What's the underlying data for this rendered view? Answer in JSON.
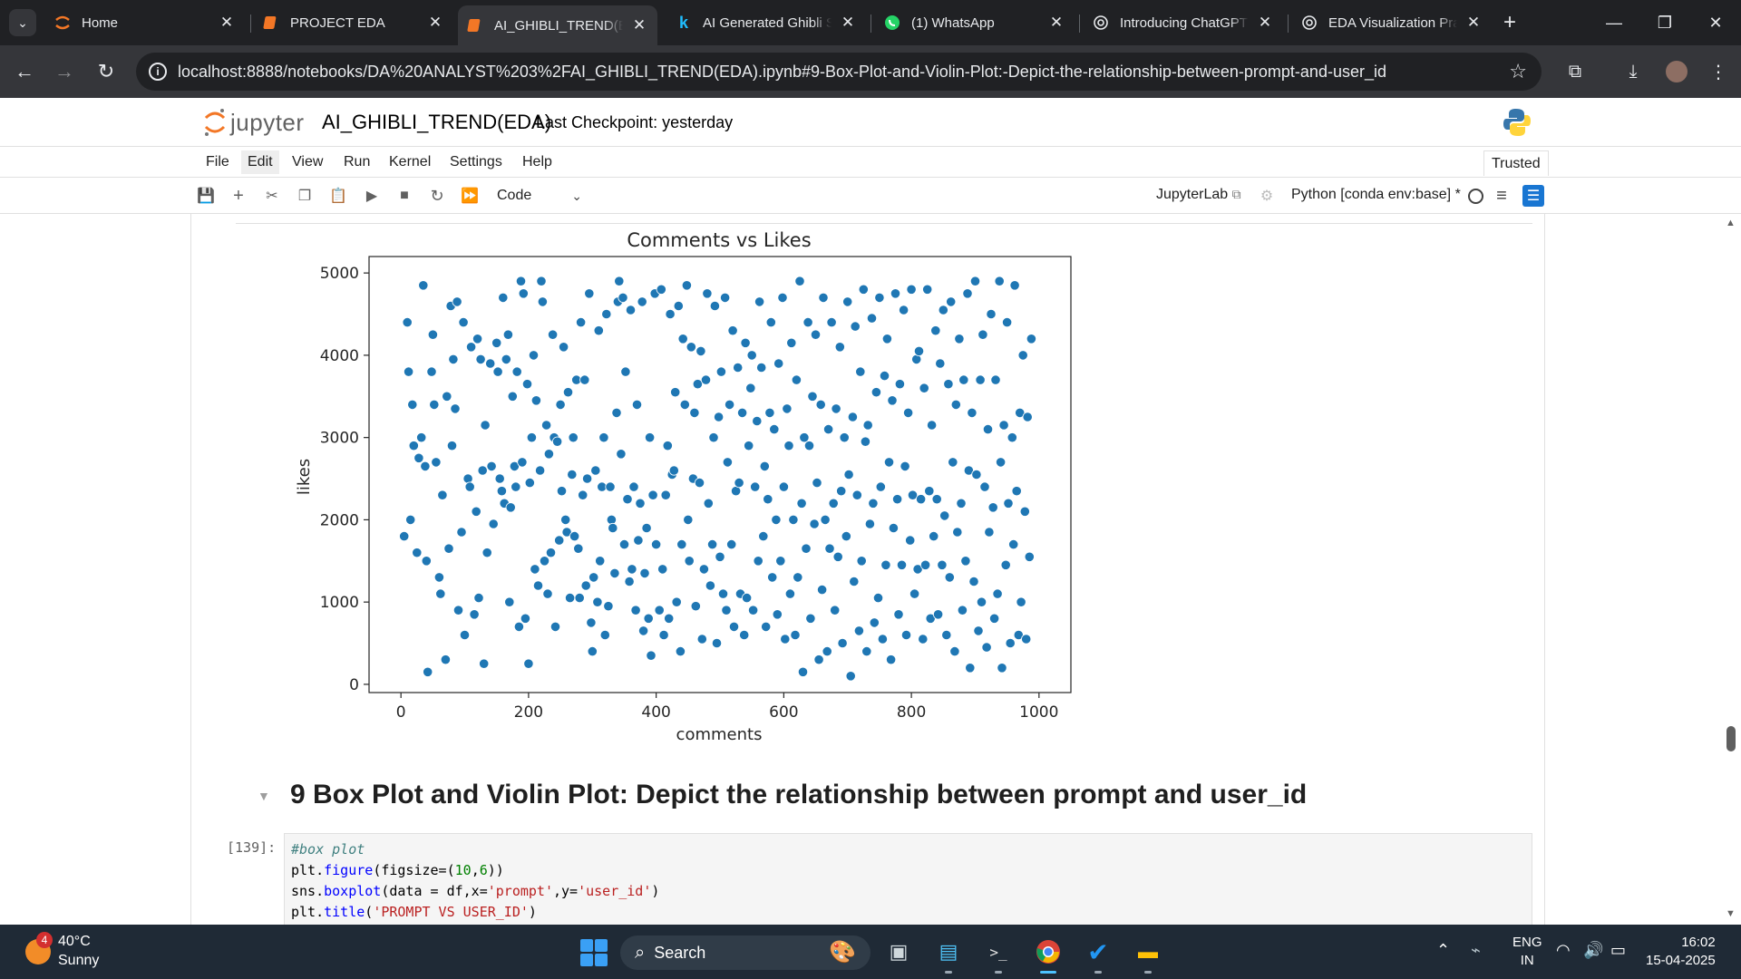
{
  "browser": {
    "tabs": [
      {
        "title": "Home",
        "icon": "jupyter-icon"
      },
      {
        "title": "PROJECT EDA",
        "icon": "jupyter-notebook-icon"
      },
      {
        "title": "AI_GHIBLI_TREND(ED",
        "icon": "jupyter-notebook-icon",
        "active": true
      },
      {
        "title": "AI Generated Ghibli S",
        "icon": "kaggle-icon"
      },
      {
        "title": "(1) WhatsApp",
        "icon": "whatsapp-icon"
      },
      {
        "title": "Introducing ChatGPT",
        "icon": "openai-icon"
      },
      {
        "title": "EDA Visualization Pra",
        "icon": "openai-icon"
      }
    ],
    "url": "localhost:8888/notebooks/DA%20ANALYST%203%2FAI_GHIBLI_TREND(EDA).ipynb#9-Box-Plot-and-Violin-Plot:-Depict-the-relationship-between-prompt-and-user_id"
  },
  "jupyter": {
    "logo_text": "jupyter",
    "notebook_title": "AI_GHIBLI_TREND(EDA)",
    "checkpoint": "Last Checkpoint: yesterday",
    "menu": [
      "File",
      "Edit",
      "View",
      "Run",
      "Kernel",
      "Settings",
      "Help"
    ],
    "trusted": "Trusted",
    "cell_type": "Code",
    "lab_link": "JupyterLab",
    "kernel": "Python [conda env:base] *"
  },
  "notebook": {
    "heading": "9 Box Plot and Violin Plot: Depict the relationship between prompt and user_id",
    "prompt": "[139]:",
    "code": {
      "line1": "#box plot",
      "line2": [
        "plt.",
        "figure",
        "(figsize=(",
        "10",
        ",",
        "6",
        "))"
      ],
      "line3": [
        "sns.",
        "boxplot",
        "(data = df,x=",
        "'prompt'",
        ",y=",
        "'user_id'",
        ")"
      ],
      "line4": [
        "plt.",
        "title",
        "(",
        "'PROMPT VS USER_ID'",
        ")"
      ]
    }
  },
  "chart_data": {
    "type": "scatter",
    "title": "Comments vs Likes",
    "xlabel": "comments",
    "ylabel": "likes",
    "xlim": [
      -50,
      1050
    ],
    "ylim": [
      -100,
      5200
    ],
    "xticks": [
      0,
      200,
      400,
      600,
      800,
      1000
    ],
    "yticks": [
      0,
      1000,
      2000,
      3000,
      4000,
      5000
    ],
    "color": "#1f77b4",
    "points": [
      [
        5,
        1800
      ],
      [
        10,
        4400
      ],
      [
        12,
        3800
      ],
      [
        15,
        2000
      ],
      [
        18,
        3400
      ],
      [
        20,
        2900
      ],
      [
        25,
        1600
      ],
      [
        28,
        2750
      ],
      [
        32,
        3000
      ],
      [
        35,
        4850
      ],
      [
        38,
        2650
      ],
      [
        40,
        1500
      ],
      [
        42,
        150
      ],
      [
        48,
        3800
      ],
      [
        50,
        4250
      ],
      [
        52,
        3400
      ],
      [
        55,
        2700
      ],
      [
        60,
        1300
      ],
      [
        62,
        1100
      ],
      [
        65,
        2300
      ],
      [
        70,
        300
      ],
      [
        72,
        3500
      ],
      [
        75,
        1650
      ],
      [
        78,
        4600
      ],
      [
        80,
        2900
      ],
      [
        82,
        3950
      ],
      [
        85,
        3350
      ],
      [
        88,
        4650
      ],
      [
        90,
        900
      ],
      [
        95,
        1850
      ],
      [
        98,
        4400
      ],
      [
        100,
        600
      ],
      [
        105,
        2500
      ],
      [
        108,
        2400
      ],
      [
        110,
        4100
      ],
      [
        115,
        850
      ],
      [
        118,
        2100
      ],
      [
        120,
        4200
      ],
      [
        122,
        1050
      ],
      [
        125,
        3950
      ],
      [
        128,
        2600
      ],
      [
        130,
        250
      ],
      [
        132,
        3150
      ],
      [
        135,
        1600
      ],
      [
        140,
        3900
      ],
      [
        142,
        2650
      ],
      [
        145,
        1950
      ],
      [
        150,
        4150
      ],
      [
        152,
        3800
      ],
      [
        155,
        2500
      ],
      [
        158,
        2350
      ],
      [
        160,
        4700
      ],
      [
        162,
        2200
      ],
      [
        165,
        3950
      ],
      [
        168,
        4250
      ],
      [
        170,
        1000
      ],
      [
        172,
        2150
      ],
      [
        175,
        3500
      ],
      [
        178,
        2650
      ],
      [
        180,
        2400
      ],
      [
        182,
        3800
      ],
      [
        185,
        700
      ],
      [
        188,
        4900
      ],
      [
        190,
        2700
      ],
      [
        192,
        4750
      ],
      [
        195,
        800
      ],
      [
        198,
        3650
      ],
      [
        200,
        250
      ],
      [
        202,
        2450
      ],
      [
        205,
        3000
      ],
      [
        208,
        4000
      ],
      [
        210,
        1400
      ],
      [
        212,
        3450
      ],
      [
        215,
        1200
      ],
      [
        218,
        2600
      ],
      [
        220,
        4900
      ],
      [
        222,
        4650
      ],
      [
        225,
        1500
      ],
      [
        228,
        3150
      ],
      [
        230,
        1100
      ],
      [
        232,
        2800
      ],
      [
        235,
        1600
      ],
      [
        238,
        4250
      ],
      [
        240,
        3000
      ],
      [
        242,
        700
      ],
      [
        245,
        2950
      ],
      [
        248,
        1750
      ],
      [
        250,
        3400
      ],
      [
        252,
        2350
      ],
      [
        255,
        4100
      ],
      [
        258,
        2000
      ],
      [
        260,
        1850
      ],
      [
        262,
        3550
      ],
      [
        265,
        1050
      ],
      [
        268,
        2550
      ],
      [
        270,
        3000
      ],
      [
        272,
        1800
      ],
      [
        275,
        3700
      ],
      [
        278,
        1650
      ],
      [
        280,
        1050
      ],
      [
        282,
        4400
      ],
      [
        285,
        2300
      ],
      [
        288,
        3700
      ],
      [
        290,
        1200
      ],
      [
        292,
        2500
      ],
      [
        295,
        4750
      ],
      [
        298,
        750
      ],
      [
        300,
        400
      ],
      [
        302,
        1300
      ],
      [
        305,
        2600
      ],
      [
        308,
        1000
      ],
      [
        310,
        4300
      ],
      [
        312,
        1500
      ],
      [
        315,
        2400
      ],
      [
        318,
        3000
      ],
      [
        320,
        600
      ],
      [
        322,
        4500
      ],
      [
        325,
        950
      ],
      [
        328,
        2400
      ],
      [
        330,
        2000
      ],
      [
        332,
        1900
      ],
      [
        335,
        1350
      ],
      [
        338,
        3300
      ],
      [
        340,
        4650
      ],
      [
        342,
        4900
      ],
      [
        345,
        2800
      ],
      [
        348,
        4700
      ],
      [
        350,
        1700
      ],
      [
        352,
        3800
      ],
      [
        355,
        2250
      ],
      [
        358,
        1250
      ],
      [
        360,
        4550
      ],
      [
        362,
        1400
      ],
      [
        365,
        2400
      ],
      [
        368,
        900
      ],
      [
        370,
        3400
      ],
      [
        372,
        1750
      ],
      [
        375,
        2200
      ],
      [
        378,
        4650
      ],
      [
        380,
        650
      ],
      [
        382,
        1350
      ],
      [
        385,
        1900
      ],
      [
        388,
        800
      ],
      [
        390,
        3000
      ],
      [
        392,
        350
      ],
      [
        395,
        2300
      ],
      [
        398,
        4750
      ],
      [
        400,
        1700
      ],
      [
        405,
        900
      ],
      [
        408,
        4800
      ],
      [
        410,
        1400
      ],
      [
        412,
        600
      ],
      [
        415,
        2300
      ],
      [
        418,
        2900
      ],
      [
        420,
        800
      ],
      [
        422,
        4500
      ],
      [
        425,
        2550
      ],
      [
        428,
        2600
      ],
      [
        430,
        3550
      ],
      [
        432,
        1000
      ],
      [
        435,
        4600
      ],
      [
        438,
        400
      ],
      [
        440,
        1700
      ],
      [
        442,
        4200
      ],
      [
        445,
        3400
      ],
      [
        448,
        4850
      ],
      [
        450,
        2000
      ],
      [
        452,
        1500
      ],
      [
        455,
        4100
      ],
      [
        458,
        2500
      ],
      [
        460,
        3300
      ],
      [
        462,
        950
      ],
      [
        465,
        3650
      ],
      [
        468,
        2450
      ],
      [
        470,
        4050
      ],
      [
        472,
        550
      ],
      [
        475,
        1400
      ],
      [
        478,
        3700
      ],
      [
        480,
        4750
      ],
      [
        482,
        2200
      ],
      [
        485,
        1200
      ],
      [
        488,
        1700
      ],
      [
        490,
        3000
      ],
      [
        492,
        4600
      ],
      [
        495,
        500
      ],
      [
        498,
        3250
      ],
      [
        500,
        1550
      ],
      [
        502,
        3800
      ],
      [
        505,
        1100
      ],
      [
        508,
        4700
      ],
      [
        510,
        900
      ],
      [
        512,
        2700
      ],
      [
        515,
        3400
      ],
      [
        518,
        1700
      ],
      [
        520,
        4300
      ],
      [
        522,
        700
      ],
      [
        525,
        2350
      ],
      [
        528,
        3850
      ],
      [
        530,
        2450
      ],
      [
        532,
        1100
      ],
      [
        535,
        3300
      ],
      [
        538,
        600
      ],
      [
        540,
        4150
      ],
      [
        542,
        1050
      ],
      [
        545,
        2900
      ],
      [
        548,
        3600
      ],
      [
        550,
        4000
      ],
      [
        552,
        900
      ],
      [
        555,
        2400
      ],
      [
        558,
        3200
      ],
      [
        560,
        1500
      ],
      [
        562,
        4650
      ],
      [
        565,
        3850
      ],
      [
        568,
        1800
      ],
      [
        570,
        2650
      ],
      [
        572,
        700
      ],
      [
        575,
        2250
      ],
      [
        578,
        3300
      ],
      [
        580,
        4400
      ],
      [
        582,
        1300
      ],
      [
        585,
        3100
      ],
      [
        588,
        2000
      ],
      [
        590,
        850
      ],
      [
        592,
        3900
      ],
      [
        595,
        1500
      ],
      [
        598,
        4700
      ],
      [
        600,
        2400
      ],
      [
        602,
        550
      ],
      [
        605,
        3350
      ],
      [
        608,
        2900
      ],
      [
        610,
        1100
      ],
      [
        612,
        4150
      ],
      [
        615,
        2000
      ],
      [
        618,
        600
      ],
      [
        620,
        3700
      ],
      [
        622,
        1300
      ],
      [
        625,
        4900
      ],
      [
        628,
        2200
      ],
      [
        630,
        150
      ],
      [
        632,
        3000
      ],
      [
        635,
        1650
      ],
      [
        638,
        4400
      ],
      [
        640,
        2900
      ],
      [
        642,
        800
      ],
      [
        645,
        3500
      ],
      [
        648,
        1950
      ],
      [
        650,
        4250
      ],
      [
        652,
        2450
      ],
      [
        655,
        300
      ],
      [
        658,
        3400
      ],
      [
        660,
        1150
      ],
      [
        662,
        4700
      ],
      [
        665,
        2000
      ],
      [
        668,
        400
      ],
      [
        670,
        3100
      ],
      [
        672,
        1650
      ],
      [
        675,
        4400
      ],
      [
        678,
        2200
      ],
      [
        680,
        900
      ],
      [
        682,
        3350
      ],
      [
        685,
        1550
      ],
      [
        688,
        4100
      ],
      [
        690,
        2350
      ],
      [
        692,
        500
      ],
      [
        695,
        3000
      ],
      [
        698,
        1800
      ],
      [
        700,
        4650
      ],
      [
        702,
        2550
      ],
      [
        705,
        100
      ],
      [
        708,
        3250
      ],
      [
        710,
        1250
      ],
      [
        712,
        4350
      ],
      [
        715,
        2300
      ],
      [
        718,
        650
      ],
      [
        720,
        3800
      ],
      [
        722,
        1500
      ],
      [
        725,
        4800
      ],
      [
        728,
        2950
      ],
      [
        730,
        400
      ],
      [
        732,
        3150
      ],
      [
        735,
        1950
      ],
      [
        738,
        4450
      ],
      [
        740,
        2200
      ],
      [
        742,
        750
      ],
      [
        745,
        3550
      ],
      [
        748,
        1050
      ],
      [
        750,
        4700
      ],
      [
        752,
        2400
      ],
      [
        755,
        550
      ],
      [
        758,
        3750
      ],
      [
        760,
        1450
      ],
      [
        762,
        4200
      ],
      [
        765,
        2700
      ],
      [
        768,
        300
      ],
      [
        770,
        3450
      ],
      [
        772,
        1900
      ],
      [
        775,
        4750
      ],
      [
        778,
        2250
      ],
      [
        780,
        850
      ],
      [
        782,
        3650
      ],
      [
        785,
        1450
      ],
      [
        788,
        4550
      ],
      [
        790,
        2650
      ],
      [
        792,
        600
      ],
      [
        795,
        3300
      ],
      [
        798,
        1750
      ],
      [
        800,
        4800
      ],
      [
        802,
        2300
      ],
      [
        805,
        1100
      ],
      [
        808,
        3950
      ],
      [
        810,
        1400
      ],
      [
        812,
        4050
      ],
      [
        815,
        2250
      ],
      [
        818,
        550
      ],
      [
        820,
        3600
      ],
      [
        822,
        1450
      ],
      [
        825,
        4800
      ],
      [
        828,
        2350
      ],
      [
        830,
        800
      ],
      [
        832,
        3150
      ],
      [
        835,
        1800
      ],
      [
        838,
        4300
      ],
      [
        840,
        2250
      ],
      [
        842,
        850
      ],
      [
        845,
        3900
      ],
      [
        848,
        1450
      ],
      [
        850,
        4550
      ],
      [
        852,
        2050
      ],
      [
        855,
        600
      ],
      [
        858,
        3650
      ],
      [
        860,
        1300
      ],
      [
        862,
        4650
      ],
      [
        865,
        2700
      ],
      [
        868,
        400
      ],
      [
        870,
        3400
      ],
      [
        872,
        1850
      ],
      [
        875,
        4200
      ],
      [
        878,
        2200
      ],
      [
        880,
        900
      ],
      [
        882,
        3700
      ],
      [
        885,
        1500
      ],
      [
        888,
        4750
      ],
      [
        890,
        2600
      ],
      [
        892,
        200
      ],
      [
        895,
        3300
      ],
      [
        898,
        1250
      ],
      [
        900,
        4900
      ],
      [
        902,
        2550
      ],
      [
        905,
        650
      ],
      [
        908,
        3700
      ],
      [
        910,
        1000
      ],
      [
        912,
        4250
      ],
      [
        915,
        2400
      ],
      [
        918,
        450
      ],
      [
        920,
        3100
      ],
      [
        922,
        1850
      ],
      [
        925,
        4500
      ],
      [
        928,
        2150
      ],
      [
        930,
        800
      ],
      [
        932,
        3700
      ],
      [
        935,
        1100
      ],
      [
        938,
        4900
      ],
      [
        940,
        2700
      ],
      [
        942,
        200
      ],
      [
        945,
        3150
      ],
      [
        948,
        1450
      ],
      [
        950,
        4400
      ],
      [
        952,
        2200
      ],
      [
        955,
        500
      ],
      [
        958,
        3000
      ],
      [
        960,
        1700
      ],
      [
        962,
        4850
      ],
      [
        965,
        2350
      ],
      [
        968,
        600
      ],
      [
        970,
        3300
      ],
      [
        972,
        1000
      ],
      [
        975,
        4000
      ],
      [
        978,
        2100
      ],
      [
        980,
        550
      ],
      [
        982,
        3250
      ],
      [
        985,
        1550
      ],
      [
        988,
        4200
      ]
    ]
  },
  "taskbar": {
    "temp": "40°C",
    "condition": "Sunny",
    "badge": "4",
    "search": "Search",
    "lang1": "ENG",
    "lang2": "IN",
    "time": "16:02",
    "date": "15-04-2025"
  }
}
